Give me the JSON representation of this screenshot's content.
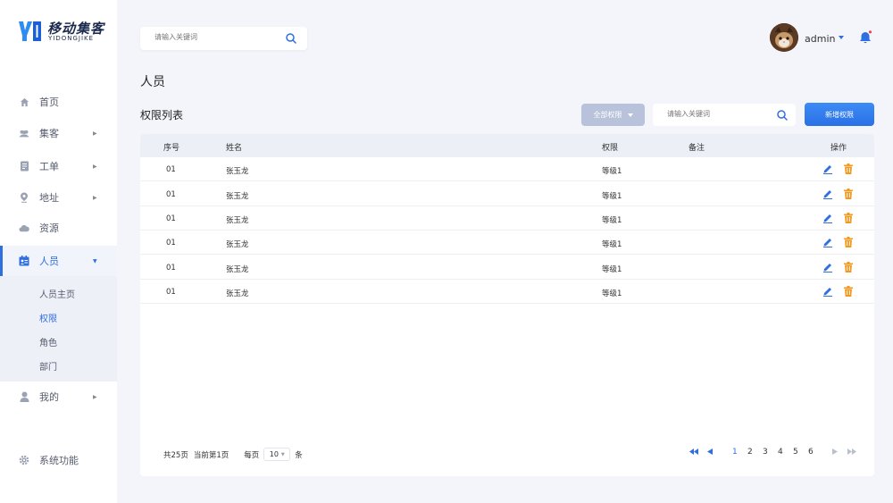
{
  "brand": {
    "title": "移动集客",
    "subtitle": "YIDONGJIKE",
    "accent": "#2f6fe0"
  },
  "sidebar": {
    "items": [
      {
        "label": "首页",
        "icon": "home-icon"
      },
      {
        "label": "集客",
        "icon": "users-icon"
      },
      {
        "label": "工单",
        "icon": "document-icon"
      },
      {
        "label": "地址",
        "icon": "location-pin-icon"
      },
      {
        "label": "资源",
        "icon": "cloud-icon"
      },
      {
        "label": "人员",
        "icon": "id-card-icon"
      },
      {
        "label": "我的",
        "icon": "user-icon"
      },
      {
        "label": "系统功能",
        "icon": "gear-icon"
      }
    ],
    "submenu": [
      {
        "label": "人员主页"
      },
      {
        "label": "权限"
      },
      {
        "label": "角色"
      },
      {
        "label": "部门"
      }
    ]
  },
  "header": {
    "search_placeholder": "请输入关键词",
    "user_name": "admin"
  },
  "page": {
    "title": "人员",
    "list_title": "权限列表",
    "filter_label": "全部权限",
    "filter_search_placeholder": "请输入关键词",
    "add_button": "新增权限"
  },
  "table": {
    "columns": [
      "序号",
      "姓名",
      "权限",
      "备注",
      "操作"
    ],
    "rows": [
      {
        "no": "01",
        "name": "张玉龙",
        "perm": "等级1",
        "note": ""
      },
      {
        "no": "01",
        "name": "张玉龙",
        "perm": "等级1",
        "note": ""
      },
      {
        "no": "01",
        "name": "张玉龙",
        "perm": "等级1",
        "note": ""
      },
      {
        "no": "01",
        "name": "张玉龙",
        "perm": "等级1",
        "note": ""
      },
      {
        "no": "01",
        "name": "张玉龙",
        "perm": "等级1",
        "note": ""
      },
      {
        "no": "01",
        "name": "张玉龙",
        "perm": "等级1",
        "note": ""
      }
    ]
  },
  "pagination": {
    "total_text": "共25页",
    "current_text": "当前第1页",
    "per_page_label": "每页",
    "per_page_value": "10",
    "per_page_unit": "条",
    "pages": [
      "1",
      "2",
      "3",
      "4",
      "5",
      "6"
    ],
    "current_page": "1"
  }
}
